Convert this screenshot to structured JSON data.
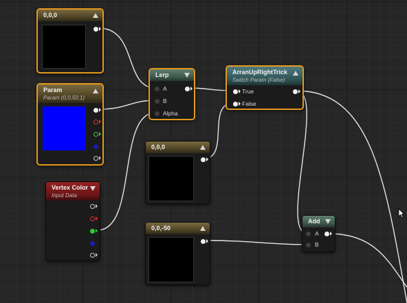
{
  "nodes": {
    "c000": {
      "title": "0,0,0"
    },
    "param": {
      "title": "Param",
      "subtitle": "Param (0,0,50,1)",
      "preview_color": "#0000ff"
    },
    "vertex": {
      "title": "Vertex Color",
      "subtitle": "Input Data"
    },
    "lerp": {
      "title": "Lerp",
      "pins": [
        "A",
        "B",
        "Alpha"
      ]
    },
    "switch": {
      "title": "ArranUpRightTrick",
      "subtitle": "Switch Param (False)",
      "pins": [
        "True",
        "False"
      ]
    },
    "c000b": {
      "title": "0,0,0"
    },
    "c0050": {
      "title": "0,0,-50"
    },
    "add": {
      "title": "Add",
      "pins": [
        "A",
        "B"
      ]
    }
  },
  "colors": {
    "selection": "#e49a1c",
    "wire": "#e8e8e8",
    "constant_header": "#6b5c35",
    "lerp_header": "#4d6b5e",
    "switch_header": "#3f6a6e",
    "vertex_header": "#8a1c1c"
  },
  "icons": {
    "collapse": "triangle-up-icon",
    "expand": "triangle-down-icon",
    "pointer": "mouse-cursor-icon"
  }
}
